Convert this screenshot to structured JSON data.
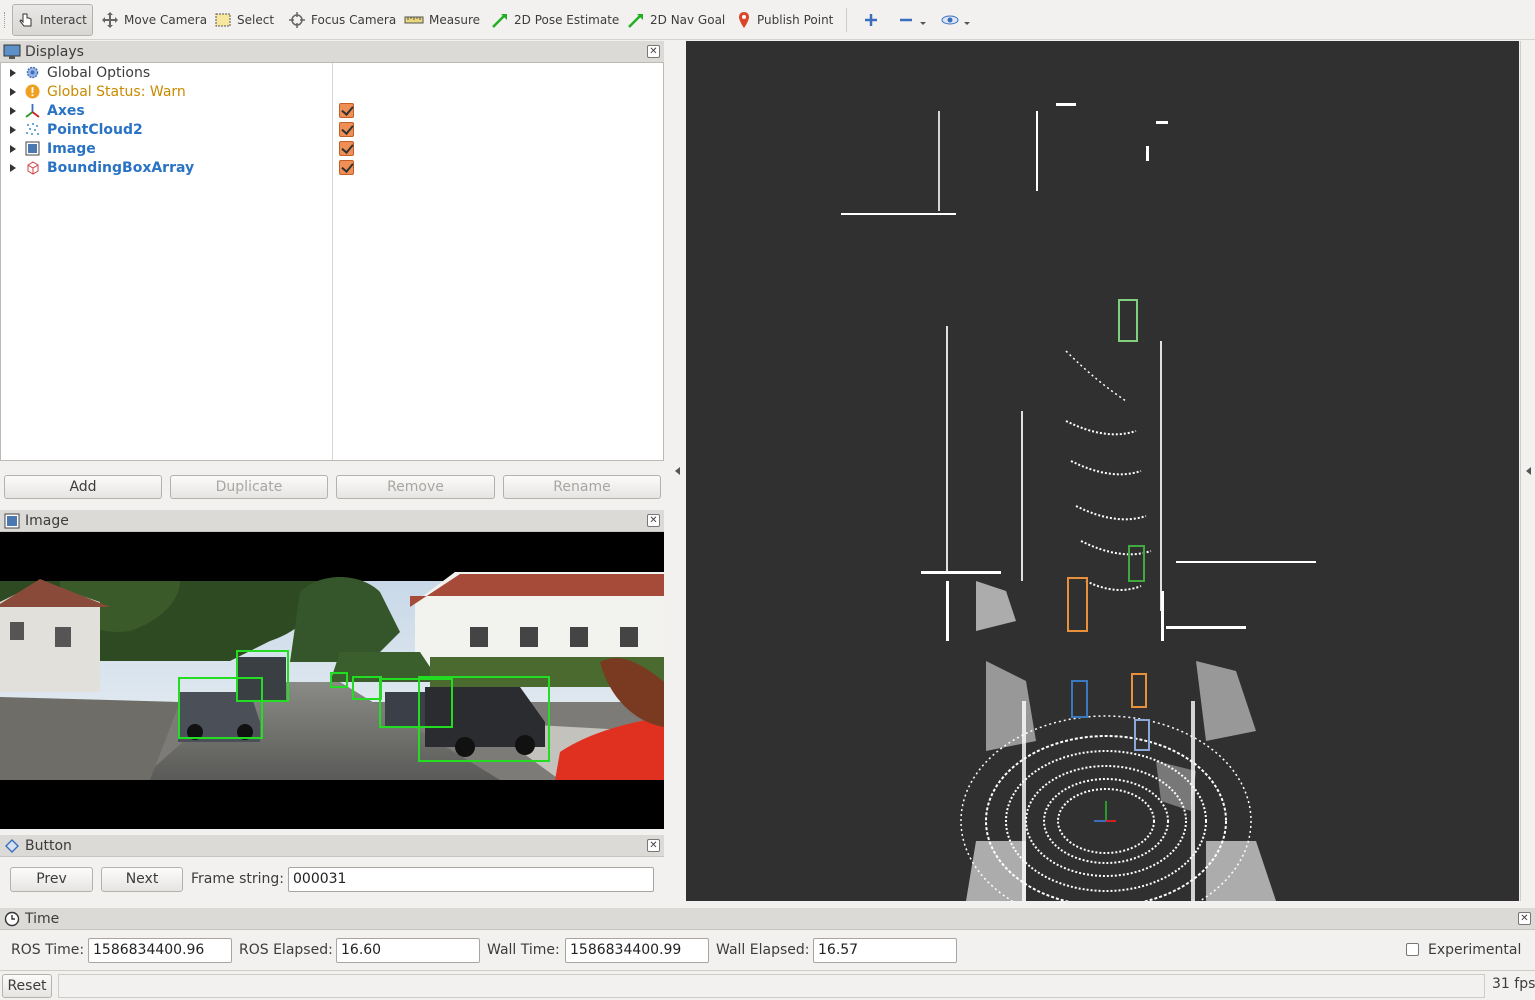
{
  "toolbar": {
    "tools": [
      {
        "label": "Interact",
        "icon": "hand-pointer-icon",
        "active": true
      },
      {
        "label": "Move Camera",
        "icon": "move-camera-icon"
      },
      {
        "label": "Select",
        "icon": "select-box-icon"
      },
      {
        "label": "Focus Camera",
        "icon": "focus-crosshair-icon"
      },
      {
        "label": "Measure",
        "icon": "ruler-icon"
      },
      {
        "label": "2D Pose Estimate",
        "icon": "green-arrow-icon"
      },
      {
        "label": "2D Nav Goal",
        "icon": "green-arrow-icon"
      },
      {
        "label": "Publish Point",
        "icon": "map-pin-icon"
      }
    ]
  },
  "displays": {
    "title": "Displays",
    "items": [
      {
        "label": "Global Options",
        "icon": "gear-icon",
        "color": "#1e1e1e",
        "bold": false,
        "checked": null
      },
      {
        "label": "Global Status: Warn",
        "icon": "warning-icon",
        "color": "#c98a00",
        "bold": false,
        "checked": null
      },
      {
        "label": "Axes",
        "icon": "axes-icon",
        "color": "#2a73c4",
        "bold": true,
        "checked": true
      },
      {
        "label": "PointCloud2",
        "icon": "pointcloud-icon",
        "color": "#2a73c4",
        "bold": true,
        "checked": true
      },
      {
        "label": "Image",
        "icon": "image-icon",
        "color": "#2a73c4",
        "bold": true,
        "checked": true
      },
      {
        "label": "BoundingBoxArray",
        "icon": "bounding-box-icon",
        "color": "#2a73c4",
        "bold": true,
        "checked": true
      }
    ],
    "buttons": {
      "add": "Add",
      "duplicate": "Duplicate",
      "remove": "Remove",
      "rename": "Rename"
    }
  },
  "image_panel": {
    "title": "Image"
  },
  "button_panel": {
    "title": "Button",
    "prev": "Prev",
    "next": "Next",
    "frame_label": "Frame string:",
    "frame_value": "000031"
  },
  "time_panel": {
    "title": "Time",
    "ros_time_label": "ROS Time:",
    "ros_time": "1586834400.96",
    "ros_elapsed_label": "ROS Elapsed:",
    "ros_elapsed": "16.60",
    "wall_time_label": "Wall Time:",
    "wall_time": "1586834400.99",
    "wall_elapsed_label": "Wall Elapsed:",
    "wall_elapsed": "16.57",
    "experimental_label": "Experimental"
  },
  "status": {
    "reset": "Reset",
    "fps": "31 fps"
  },
  "colors": {
    "accent_blue": "#2a73c4",
    "warn": "#c98a00",
    "checkbox": "#f08f55",
    "render_bg": "#303030",
    "detection_box": "#22dd22"
  }
}
